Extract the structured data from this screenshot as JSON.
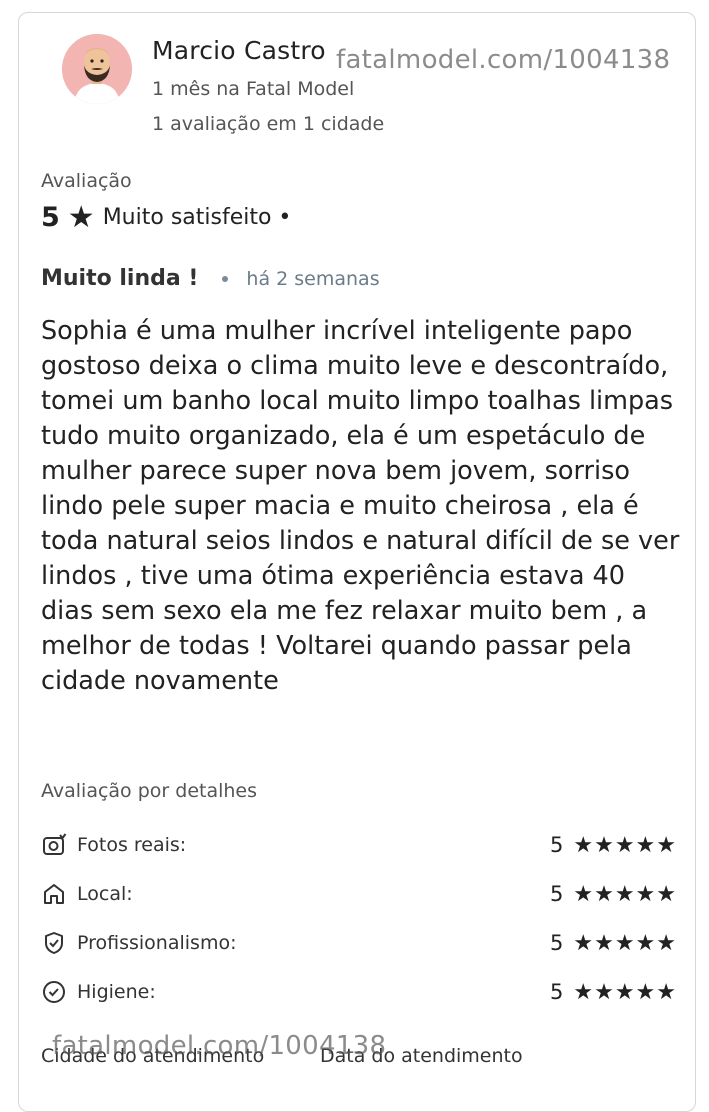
{
  "reviewer": {
    "name": "Marcio Castro",
    "tenure": "1 mês na Fatal Model",
    "reviews_summary": "1 avaliação em 1 cidade"
  },
  "watermark_text": "fatalmodel.com/1004138",
  "rating": {
    "label": "Avaliação",
    "score": "5",
    "star_icon": "star-icon",
    "satisfaction": "Muito satisfeito •"
  },
  "review": {
    "title": "Muito linda !",
    "time": "há 2 semanas",
    "body": "Sophia é uma mulher incrível inteligente papo gostoso deixa o clima muito leve e descontraído, tomei um banho local muito limpo toalhas limpas tudo muito organizado, ela é um espetáculo de mulher parece super nova bem jovem, sorriso lindo pele super macia e muito cheirosa , ela é toda natural seios lindos e natural difícil de se ver lindos , tive uma ótima experiência estava 40 dias sem sexo ela me fez relaxar muito bem , a melhor de todas ! Voltarei quando passar pela cidade novamente"
  },
  "details": {
    "heading": "Avaliação por detalhes",
    "items": [
      {
        "label": "Fotos reais:",
        "score": "5",
        "stars": "★★★★★",
        "icon": "camera-icon",
        "rating": 5
      },
      {
        "label": "Local:",
        "score": "5",
        "stars": "★★★★★",
        "icon": "home-icon",
        "rating": 5
      },
      {
        "label": "Profissionalismo:",
        "score": "5",
        "stars": "★★★★★",
        "icon": "shield-check-icon",
        "rating": 5
      },
      {
        "label": "Higiene:",
        "score": "5",
        "stars": "★★★★★",
        "icon": "check-circle-icon",
        "rating": 5
      }
    ]
  },
  "footer": {
    "city_label": "Cidade do atendimento",
    "date_label": "Data do atendimento"
  }
}
